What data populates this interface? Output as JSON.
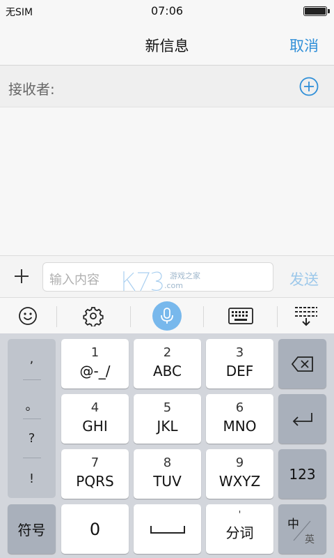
{
  "status": {
    "carrier": "无SIM",
    "time": "07:06"
  },
  "nav": {
    "title": "新信息",
    "cancel": "取消"
  },
  "recipient": {
    "label": "接收者:"
  },
  "compose": {
    "placeholder": "输入内容",
    "send": "发送",
    "watermark": "k73 游戏之家 .com"
  },
  "toolbar": {
    "icons": [
      "emoji-icon",
      "gear-icon",
      "microphone-icon",
      "keyboard-icon",
      "collapse-keyboard-icon"
    ]
  },
  "keyboard": {
    "punctuation": [
      ",",
      "。",
      "?",
      "!"
    ],
    "keys": [
      {
        "num": "1",
        "letters": "@-_/"
      },
      {
        "num": "2",
        "letters": "ABC"
      },
      {
        "num": "3",
        "letters": "DEF"
      },
      {
        "num": "4",
        "letters": "GHI"
      },
      {
        "num": "5",
        "letters": "JKL"
      },
      {
        "num": "6",
        "letters": "MNO"
      },
      {
        "num": "7",
        "letters": "PQRS"
      },
      {
        "num": "8",
        "letters": "TUV"
      },
      {
        "num": "9",
        "letters": "WXYZ"
      }
    ],
    "symbols": "符号",
    "zero": "0",
    "segment_mark": "'",
    "segment": "分词",
    "number_mode": "123",
    "lang_zh": "中",
    "lang_en": "英"
  },
  "colors": {
    "accent": "#2f8fd8",
    "send_disabled": "#9dc8ea",
    "mic_bubble": "#78b8ec",
    "keyboard_bg": "#d3d6dc"
  }
}
